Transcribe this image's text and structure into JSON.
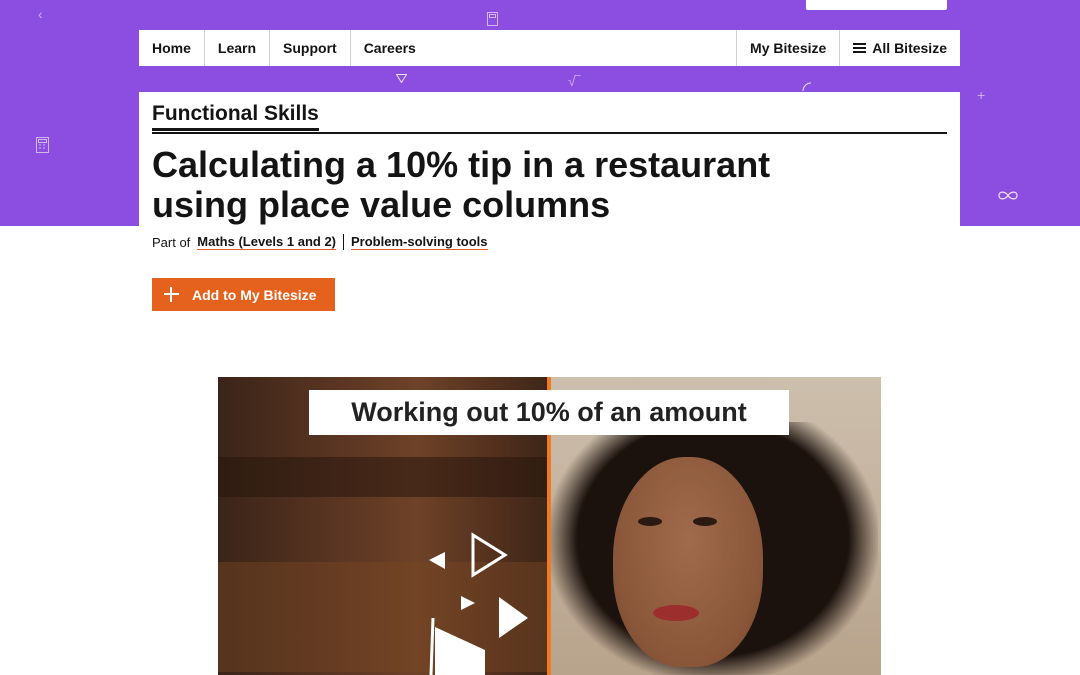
{
  "nav": {
    "home": "Home",
    "learn": "Learn",
    "support": "Support",
    "careers": "Careers",
    "my_bitesize": "My Bitesize",
    "all_bitesize": "All Bitesize"
  },
  "article": {
    "subject": "Functional Skills",
    "title": "Calculating a 10% tip in a restaurant using place value columns",
    "part_of_label": "Part of",
    "part_of_links": [
      "Maths (Levels 1 and 2)",
      "Problem-solving tools"
    ],
    "add_button": "Add to My Bitesize"
  },
  "video": {
    "caption": "Working out 10% of an amount"
  },
  "colors": {
    "brand_purple": "#8c4ee0",
    "accent_orange": "#e4621e"
  }
}
